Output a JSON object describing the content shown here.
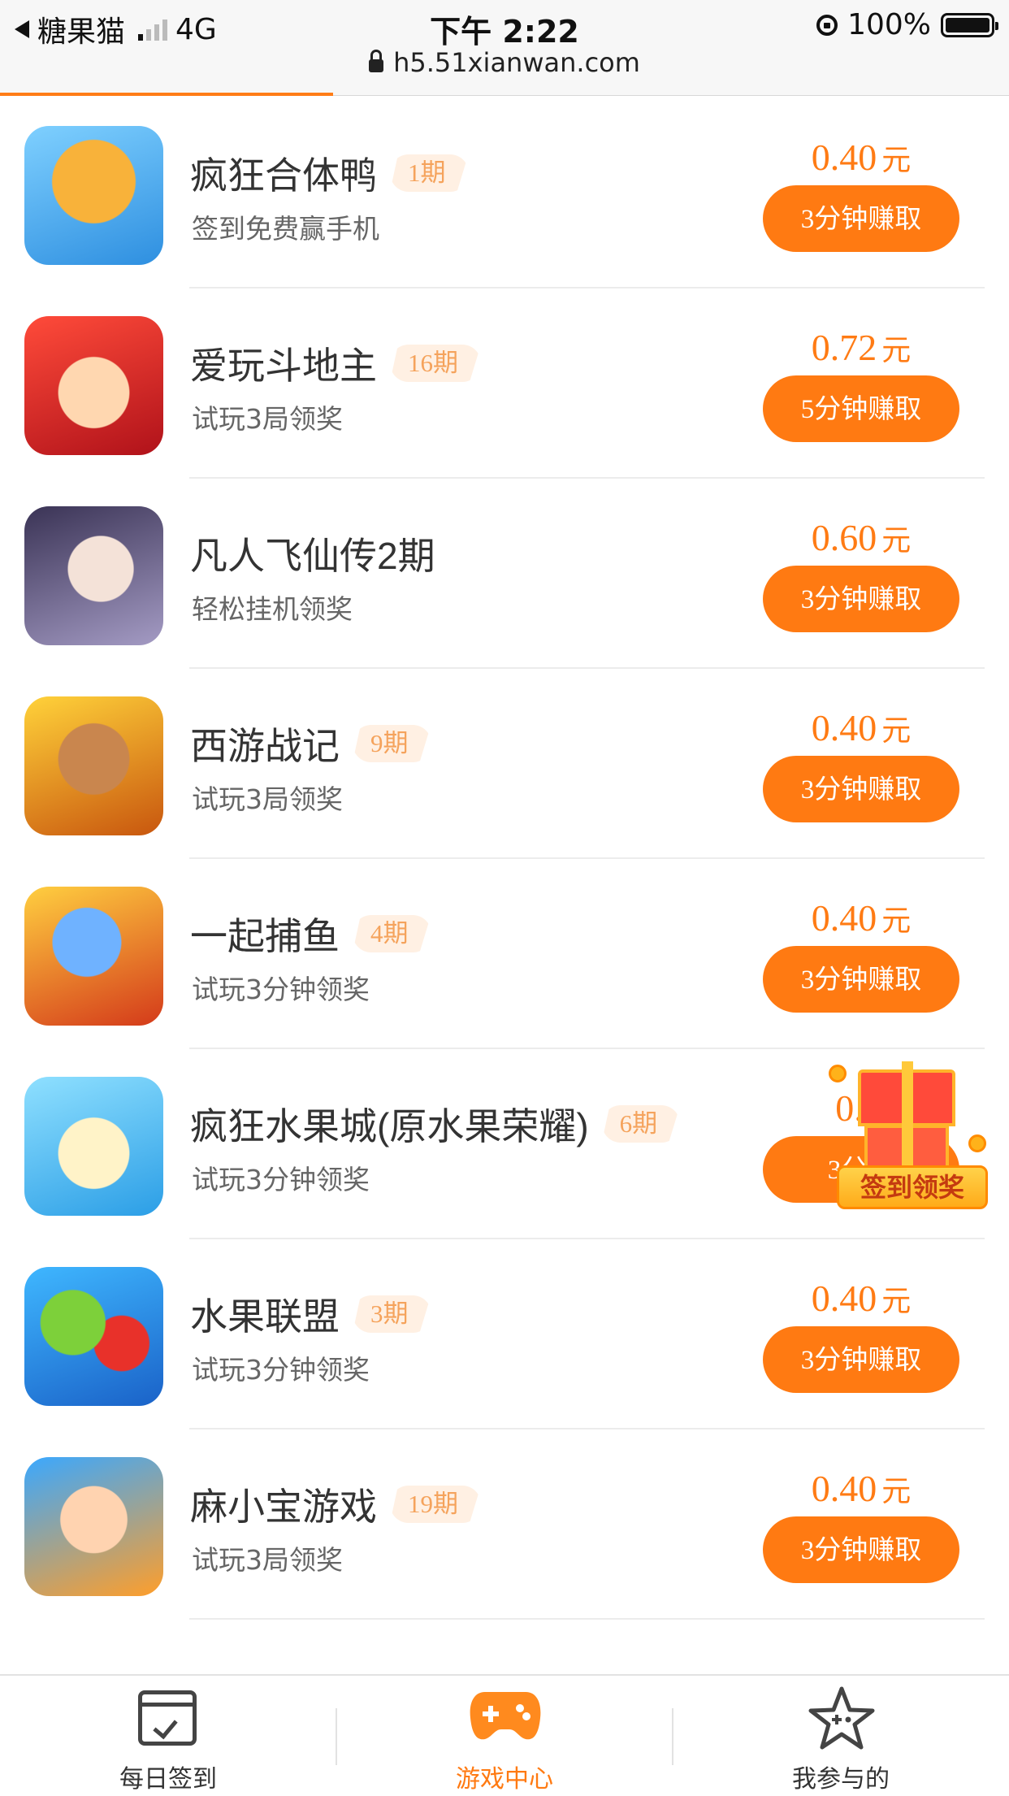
{
  "status_bar": {
    "back_app": "糖果猫",
    "network": "4G",
    "time": "下午 2:22",
    "battery": "100%"
  },
  "url_bar": {
    "url": "h5.51xianwan.com"
  },
  "page_load_progress": 0.33,
  "accent_color": "#ff7a12",
  "games": [
    {
      "title": "疯狂合体鸭",
      "badge": "1期",
      "subtitle": "签到免费赢手机",
      "amount": "0.40",
      "unit": "元",
      "button": "3分钟赚取",
      "icon": "duck-game-icon"
    },
    {
      "title": "爱玩斗地主",
      "badge": "16期",
      "subtitle": "试玩3局领奖",
      "amount": "0.72",
      "unit": "元",
      "button": "5分钟赚取",
      "icon": "landlord-game-icon"
    },
    {
      "title": "凡人飞仙传2期",
      "badge": "",
      "subtitle": "轻松挂机领奖",
      "amount": "0.60",
      "unit": "元",
      "button": "3分钟赚取",
      "icon": "fairy-game-icon"
    },
    {
      "title": "西游战记",
      "badge": "9期",
      "subtitle": "试玩3局领奖",
      "amount": "0.40",
      "unit": "元",
      "button": "3分钟赚取",
      "icon": "monkey-king-game-icon"
    },
    {
      "title": "一起捕鱼",
      "badge": "4期",
      "subtitle": "试玩3分钟领奖",
      "amount": "0.40",
      "unit": "元",
      "button": "3分钟赚取",
      "icon": "shark-fishing-game-icon"
    },
    {
      "title": "疯狂水果城(原水果荣耀)",
      "badge": "6期",
      "subtitle": "试玩3分钟领奖",
      "amount": "0.4",
      "unit": "",
      "button": "3分钟",
      "icon": "fruit-city-game-icon"
    },
    {
      "title": "水果联盟",
      "badge": "3期",
      "subtitle": "试玩3分钟领奖",
      "amount": "0.40",
      "unit": "元",
      "button": "3分钟赚取",
      "icon": "fruit-league-game-icon"
    },
    {
      "title": "麻小宝游戏",
      "badge": "19期",
      "subtitle": "试玩3局领奖",
      "amount": "0.40",
      "unit": "元",
      "button": "3分钟赚取",
      "icon": "mahjong-game-icon"
    }
  ],
  "floating_gift": {
    "label": "签到领奖",
    "icon": "gift-box-icon"
  },
  "bottom_nav": [
    {
      "label": "每日签到",
      "icon": "calendar-check-icon"
    },
    {
      "label": "游戏中心",
      "icon": "gamepad-icon",
      "active": true
    },
    {
      "label": "我参与的",
      "icon": "star-icon"
    }
  ]
}
